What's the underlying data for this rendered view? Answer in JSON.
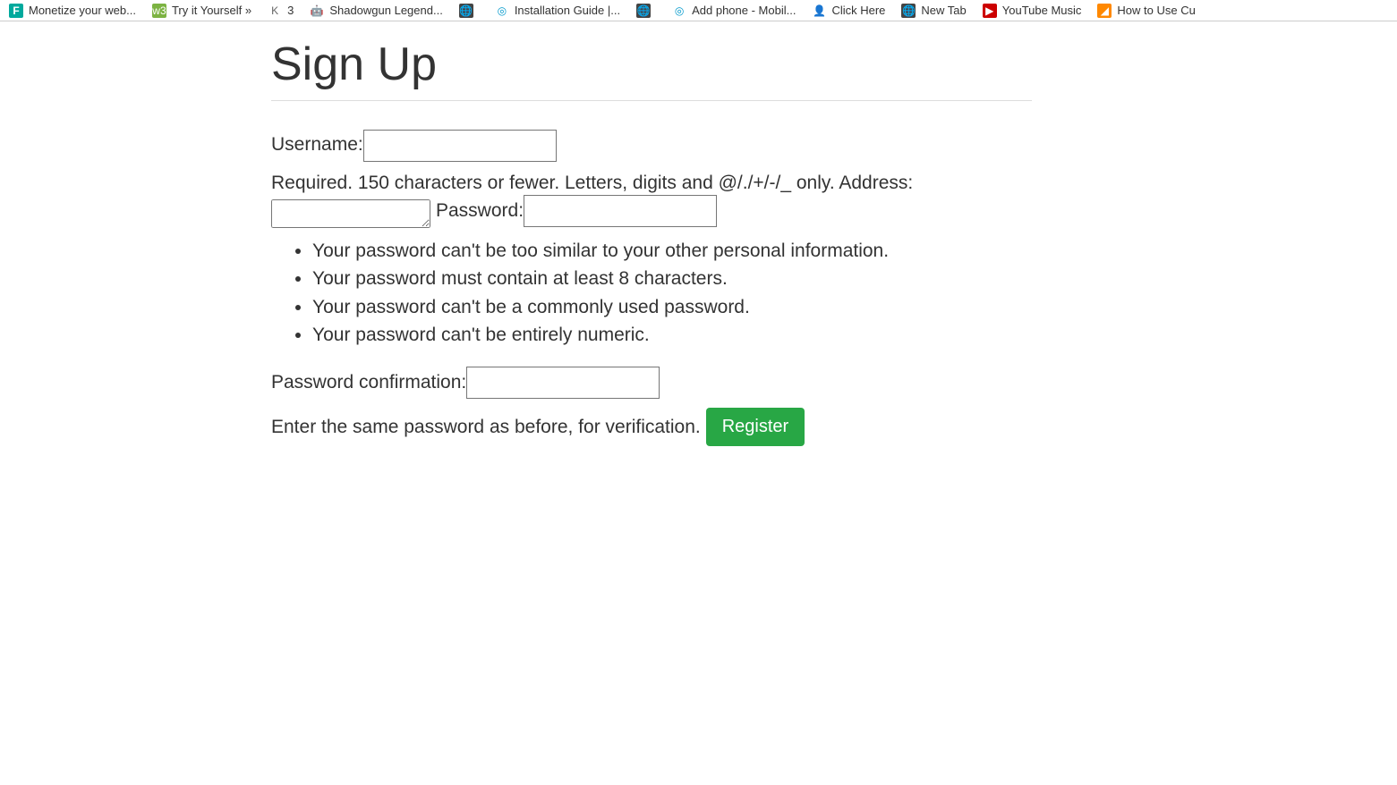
{
  "bookmarks": [
    {
      "label": "Monetize your web..."
    },
    {
      "label": "Try it Yourself »"
    },
    {
      "label": "3"
    },
    {
      "label": "Shadowgun Legend..."
    },
    {
      "label": ""
    },
    {
      "label": "Installation Guide |..."
    },
    {
      "label": ""
    },
    {
      "label": "Add phone - Mobil..."
    },
    {
      "label": "Click Here"
    },
    {
      "label": "New Tab"
    },
    {
      "label": "YouTube Music"
    },
    {
      "label": "How to Use Cu"
    }
  ],
  "page": {
    "title": "Sign Up"
  },
  "form": {
    "username_label": "Username:",
    "username_help": "Required. 150 characters or fewer. Letters, digits and @/./+/-/_ only.",
    "address_label": "Address:",
    "password_label": "Password:",
    "password_rules": [
      "Your password can't be too similar to your other personal information.",
      "Your password must contain at least 8 characters.",
      "Your password can't be a commonly used password.",
      "Your password can't be entirely numeric."
    ],
    "password_confirm_label": "Password confirmation:",
    "password_confirm_help": "Enter the same password as before, for verification.",
    "register_button": "Register"
  }
}
